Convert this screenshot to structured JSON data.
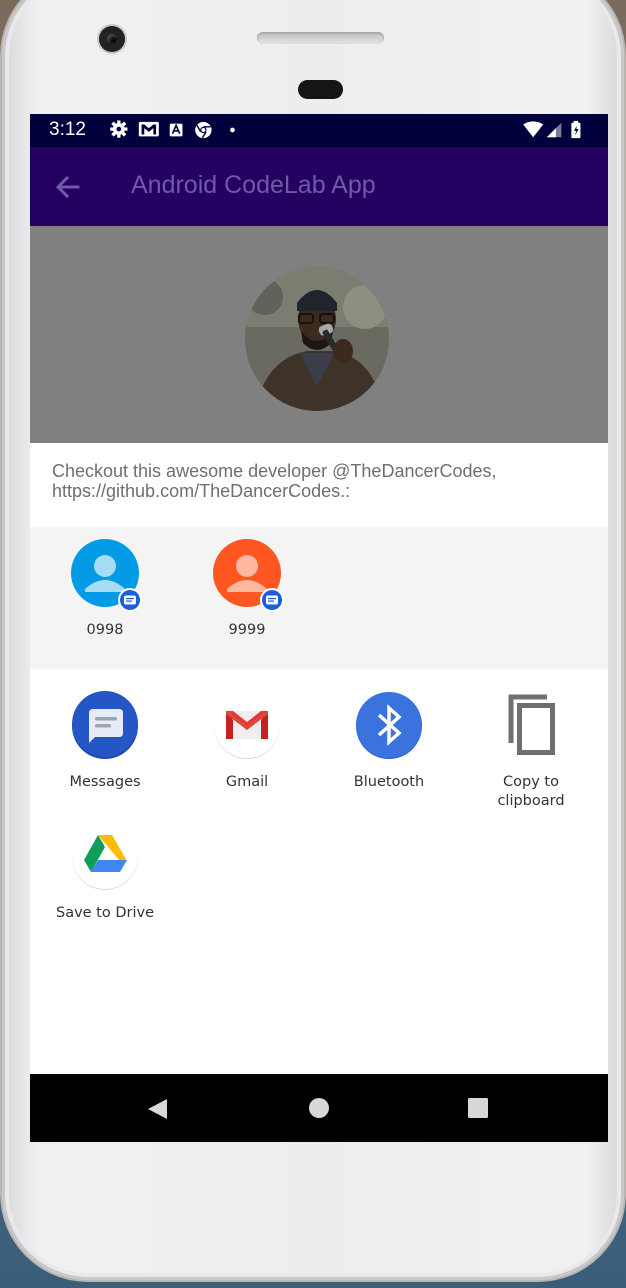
{
  "status_bar": {
    "time": "3:12"
  },
  "app_bar": {
    "title": "Android CodeLab App"
  },
  "share_sheet": {
    "text": "Checkout this awesome developer @TheDancerCodes, https://github.com/TheDancerCodes.:",
    "direct_targets": [
      {
        "label": "0998",
        "color": "#039be5",
        "icon": "person-icon"
      },
      {
        "label": "9999",
        "color": "#ff5722",
        "icon": "person-icon"
      }
    ],
    "apps": [
      {
        "label": "Messages",
        "icon": "messages-icon"
      },
      {
        "label": "Gmail",
        "icon": "gmail-icon"
      },
      {
        "label": "Bluetooth",
        "icon": "bluetooth-icon"
      },
      {
        "label": "Copy to clipboard",
        "icon": "copy-icon"
      },
      {
        "label": "Save to Drive",
        "icon": "drive-icon"
      }
    ]
  },
  "colors": {
    "status_bar": "#00003c",
    "app_bar": "#240060",
    "title": "#6e5aa6",
    "hero_scrim": "#808080"
  }
}
